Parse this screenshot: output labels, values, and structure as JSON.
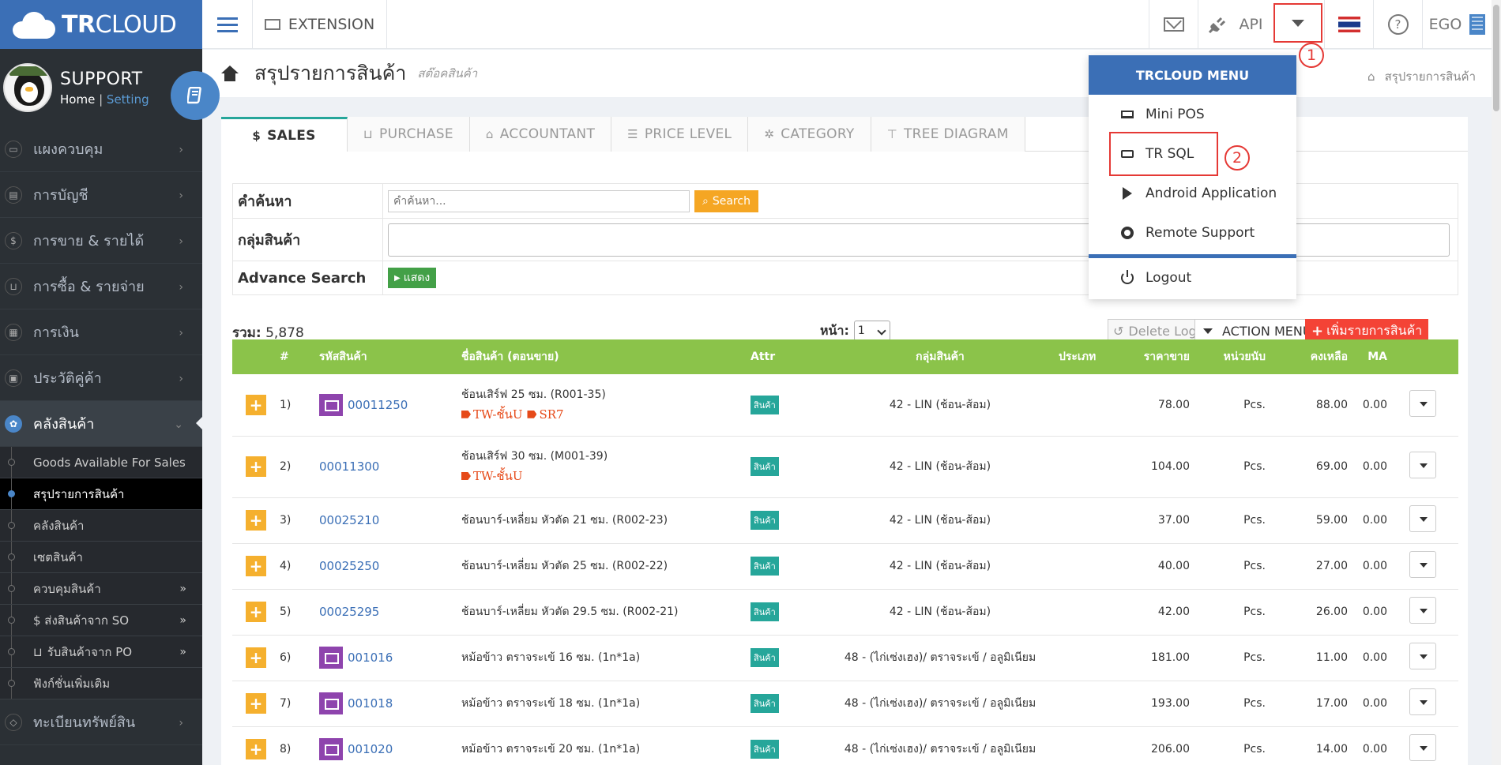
{
  "brand": {
    "name_bold": "TR",
    "name_rest": "CLOUD"
  },
  "profile": {
    "name": "SUPPORT",
    "home": "Home",
    "sep": "|",
    "setting": "Setting"
  },
  "topbar": {
    "extension": "EXTENSION",
    "api": "API",
    "user": "EGO"
  },
  "annotations": {
    "one": "1",
    "two": "2"
  },
  "sidebar": {
    "items": [
      {
        "label": "แผงควบคุม",
        "icon": "monitor-icon"
      },
      {
        "label": "การบัญชี",
        "icon": "book-icon"
      },
      {
        "label": "การขาย & รายได้",
        "icon": "dollar-icon"
      },
      {
        "label": "การซื้อ & รายจ่าย",
        "icon": "cart-icon"
      },
      {
        "label": "การเงิน",
        "icon": "calendar-icon"
      },
      {
        "label": "ประวัติคู่ค้า",
        "icon": "contact-icon"
      }
    ],
    "active": {
      "label": "คลังสินค้า",
      "icon": "cubes-icon"
    },
    "sub": [
      {
        "label": "Goods Available For Sales"
      },
      {
        "label": "สรุปรายการสินค้า"
      },
      {
        "label": "คลังสินค้า"
      },
      {
        "label": "เซตสินค้า"
      },
      {
        "label": "ควบคุมสินค้า"
      },
      {
        "label": "$ ส่งสินค้าจาก SO"
      },
      {
        "label": "รับสินค้าจาก PO"
      },
      {
        "label": "ฟังก์ชั่นเพิ่มเติม"
      }
    ],
    "last": {
      "label": "ทะเบียนทรัพย์สิน",
      "icon": "diamond-icon"
    }
  },
  "page": {
    "title": "สรุปรายการสินค้า",
    "subtitle": "สต๊อคสินค้า",
    "breadcrumb": "สรุปรายการสินค้า"
  },
  "tabs": [
    "SALES",
    "PURCHASE",
    "ACCOUNTANT",
    "PRICE LEVEL",
    "CATEGORY",
    "TREE DIAGRAM"
  ],
  "search": {
    "label": "คำค้นหา",
    "placeholder": "คำค้นหา...",
    "button": "Search",
    "group_label": "กลุ่มสินค้า",
    "advance_label": "Advance Search",
    "show_button": "แสดง"
  },
  "summary": {
    "total_label": "รวม:",
    "total_value": "5,878",
    "page_label": "หน้า:",
    "page_value": "1",
    "delete_log": "Delete Log",
    "action_menu": "ACTION MENU",
    "add_item": "เพิ่มรายการสินค้า"
  },
  "table": {
    "headers": [
      "#",
      "รหัสสินค้า",
      "ชื่อสินค้า (ตอนขาย)",
      "Attr",
      "กลุ่มสินค้า",
      "ประเภท",
      "ราคาขาย",
      "หน่วยนับ",
      "คงเหลือ",
      "MA"
    ],
    "rows": [
      {
        "n": "1)",
        "code": "00011250",
        "img": true,
        "name": "ช้อนเสิร์ฟ 25 ซม. (R001-35)",
        "tags": [
          "TW-ชั้นU",
          "SR7"
        ],
        "attr": "สินค้า",
        "group": "42 - LIN (ช้อน-ส้อม)",
        "type": "",
        "price": "78.00",
        "unit": "Pcs.",
        "rem": "88.00",
        "ma": "0.00"
      },
      {
        "n": "2)",
        "code": "00011300",
        "img": false,
        "name": "ช้อนเสิร์ฟ 30 ซม. (M001-39)",
        "tags": [
          "TW-ชั้นU"
        ],
        "attr": "สินค้า",
        "group": "42 - LIN (ช้อน-ส้อม)",
        "type": "",
        "price": "104.00",
        "unit": "Pcs.",
        "rem": "69.00",
        "ma": "0.00"
      },
      {
        "n": "3)",
        "code": "00025210",
        "img": false,
        "name": "ช้อนบาร์-เหลี่ยม หัวตัด 21 ซม. (R002-23)",
        "tags": [],
        "attr": "สินค้า",
        "group": "42 - LIN (ช้อน-ส้อม)",
        "type": "",
        "price": "37.00",
        "unit": "Pcs.",
        "rem": "59.00",
        "ma": "0.00"
      },
      {
        "n": "4)",
        "code": "00025250",
        "img": false,
        "name": "ช้อนบาร์-เหลี่ยม หัวตัด 25 ซม. (R002-22)",
        "tags": [],
        "attr": "สินค้า",
        "group": "42 - LIN (ช้อน-ส้อม)",
        "type": "",
        "price": "40.00",
        "unit": "Pcs.",
        "rem": "27.00",
        "ma": "0.00"
      },
      {
        "n": "5)",
        "code": "00025295",
        "img": false,
        "name": "ช้อนบาร์-เหลี่ยม หัวตัด 29.5 ซม. (R002-21)",
        "tags": [],
        "attr": "สินค้า",
        "group": "42 - LIN (ช้อน-ส้อม)",
        "type": "",
        "price": "42.00",
        "unit": "Pcs.",
        "rem": "26.00",
        "ma": "0.00"
      },
      {
        "n": "6)",
        "code": "001016",
        "img": true,
        "name": "หม้อข้าว ตราจระเข้ 16 ซม. (1n*1a)",
        "tags": [],
        "attr": "สินค้า",
        "group": "48 - (ไก่เซ่งเฮง)/ ตราจระเข้ / อลูมิเนียม",
        "type": "",
        "price": "181.00",
        "unit": "Pcs.",
        "rem": "11.00",
        "ma": "0.00"
      },
      {
        "n": "7)",
        "code": "001018",
        "img": true,
        "name": "หม้อข้าว ตราจระเข้ 18 ซม. (1n*1a)",
        "tags": [],
        "attr": "สินค้า",
        "group": "48 - (ไก่เซ่งเฮง)/ ตราจระเข้ / อลูมิเนียม",
        "type": "",
        "price": "193.00",
        "unit": "Pcs.",
        "rem": "17.00",
        "ma": "0.00"
      },
      {
        "n": "8)",
        "code": "001020",
        "img": true,
        "name": "หม้อข้าว ตราจระเข้ 20 ซม. (1n*1a)",
        "tags": [],
        "attr": "สินค้า",
        "group": "48 - (ไก่เซ่งเฮง)/ ตราจระเข้ / อลูมิเนียม",
        "type": "",
        "price": "206.00",
        "unit": "Pcs.",
        "rem": "14.00",
        "ma": "0.00"
      }
    ]
  },
  "dropdown": {
    "header": "TRCLOUD MENU",
    "items": [
      {
        "label": "Mini POS",
        "icon": "laptop-icon"
      },
      {
        "label": "TR SQL",
        "icon": "hdd-icon"
      },
      {
        "label": "Android Application",
        "icon": "play-icon"
      },
      {
        "label": "Remote Support",
        "icon": "life-ring-icon"
      }
    ],
    "logout": "Logout"
  },
  "colors": {
    "brand": "#3b6fb6",
    "sidebar": "#2b3035",
    "table_header": "#8bc34a",
    "accent_orange": "#f5a623",
    "badge": "#26a69a",
    "annotation": "#e53935"
  }
}
